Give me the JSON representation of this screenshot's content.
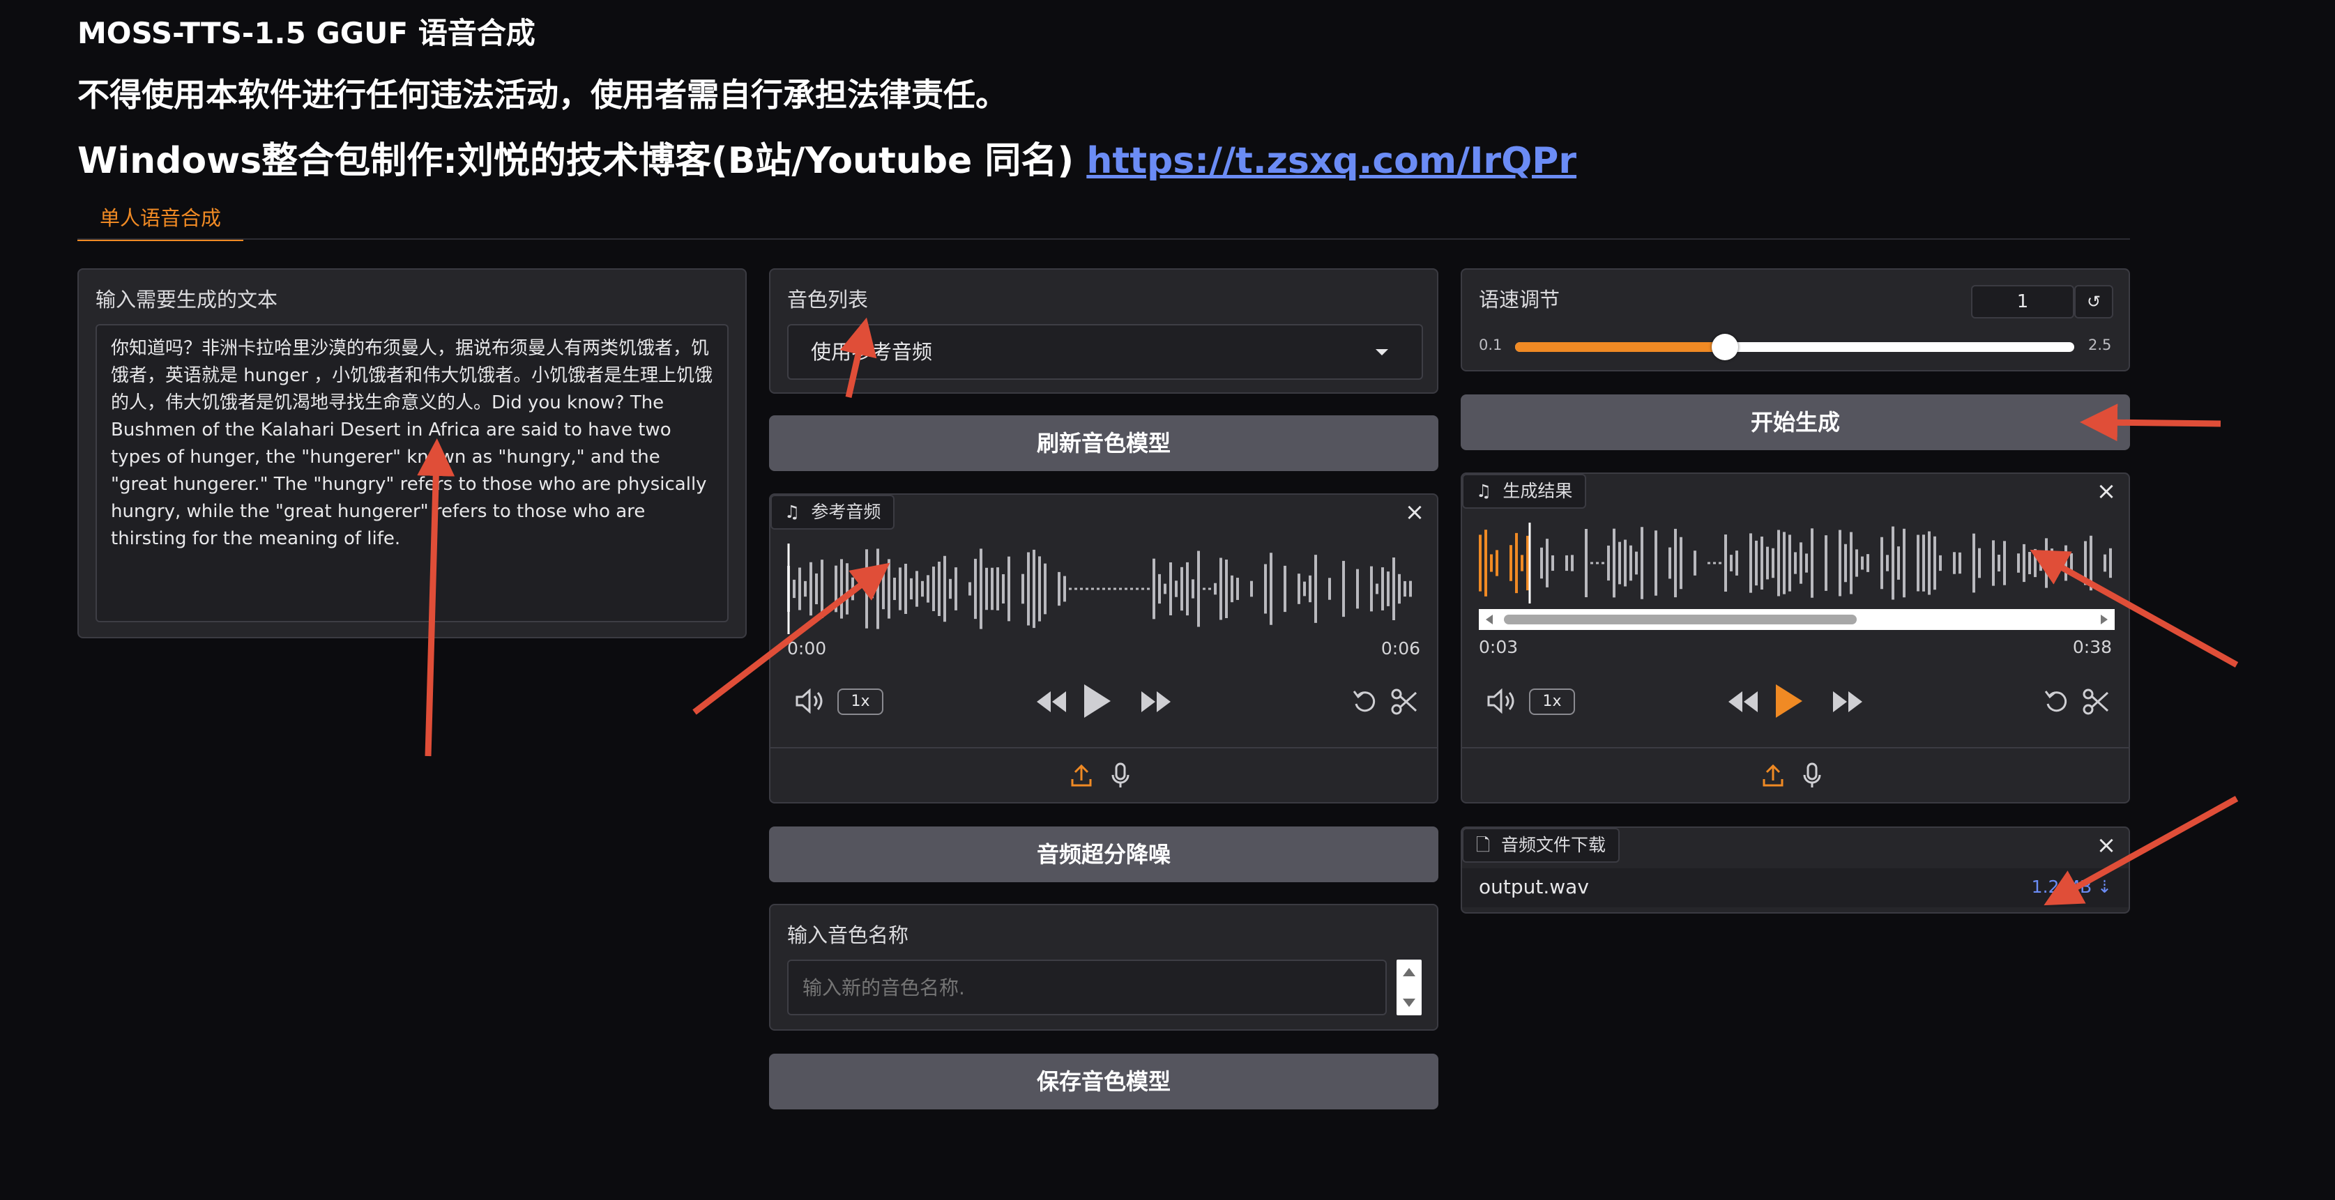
{
  "header": {
    "title": "MOSS-TTS-1.5 GGUF 语音合成",
    "disclaimer": "不得使用本软件进行任何违法活动，使用者需自行承担法律责任。",
    "credit": "Windows整合包制作:刘悦的技术博客(B站/Youtube 同名)",
    "link": "https://t.zsxq.com/IrQPr"
  },
  "tabs": [
    {
      "label": "单人语音合成",
      "active": true
    }
  ],
  "text_input": {
    "label": "输入需要生成的文本",
    "value": "你知道吗？非洲卡拉哈里沙漠的布须曼人，据说布须曼人有两类饥饿者，饥饿者，英语就是 hunger ，小饥饿者和伟大饥饿者。小饥饿者是生理上饥饿的人，伟大饥饿者是饥渴地寻找生命意义的人。Did you know? The Bushmen of the Kalahari Desert in Africa are said to have two types of hunger, the \"hungerer\" known as \"hungry,\" and the \"great hungerer.\" The \"hungry\" refers to those who are physically hungry, while the \"great hungerer\" refers to those who are thirsting for the meaning of life."
  },
  "voice_list": {
    "label": "音色列表",
    "selected": "使用参考音频"
  },
  "buttons": {
    "refresh": "刷新音色模型",
    "denoise": "音频超分降噪",
    "save": "保存音色模型",
    "generate": "开始生成"
  },
  "reference_audio": {
    "label": "参考音频",
    "time_start": "0:00",
    "time_end": "0:06",
    "speed": "1x",
    "progress": 0
  },
  "voice_name": {
    "label": "输入音色名称",
    "placeholder": "输入新的音色名称."
  },
  "speed_control": {
    "label": "语速调节",
    "value": "1",
    "min": "0.1",
    "max": "2.5",
    "current": 1
  },
  "result_audio": {
    "label": "生成结果",
    "time_current": "0:03",
    "time_end": "0:38",
    "speed": "1x",
    "progress": 0.08
  },
  "download": {
    "label": "音频文件下载",
    "file_name": "output.wav",
    "file_size": "1.2 MB ⇣"
  },
  "colors": {
    "accent": "#f08a24",
    "link": "#6b8cf5",
    "arrow": "#e04e38",
    "panel": "#26262a",
    "button": "#55555e",
    "background": "#0c0c0f"
  },
  "icons": [
    "music-note-icon",
    "close-icon",
    "volume-icon",
    "rewind-icon",
    "play-icon",
    "forward-icon",
    "undo-icon",
    "scissors-icon",
    "upload-icon",
    "microphone-icon",
    "file-icon",
    "reset-icon",
    "chevron-down-icon"
  ]
}
